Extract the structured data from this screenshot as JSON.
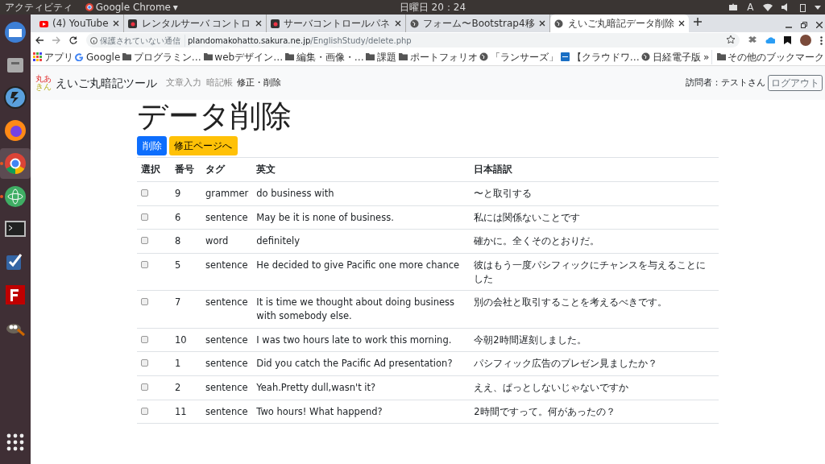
{
  "top_bar": {
    "activities": "アクティビティ",
    "app_menu": "Google Chrome",
    "app_caret": "▾",
    "clock": "日曜日 20：24",
    "input_method": "A"
  },
  "dock": [
    {
      "kind": "mail",
      "running": false,
      "selected": false
    },
    {
      "kind": "drawer",
      "running": false,
      "selected": false
    },
    {
      "kind": "bolt",
      "running": false,
      "selected": false
    },
    {
      "kind": "firefox",
      "running": false,
      "selected": false
    },
    {
      "kind": "chrome",
      "running": true,
      "selected": true
    },
    {
      "kind": "atom",
      "running": true,
      "selected": false
    },
    {
      "kind": "terminal",
      "running": false,
      "selected": false
    },
    {
      "kind": "tasks",
      "running": false,
      "selected": false
    },
    {
      "kind": "filezilla",
      "running": false,
      "selected": false
    },
    {
      "kind": "gimp",
      "running": false,
      "selected": false
    }
  ],
  "tabs": [
    {
      "kind": "youtube",
      "title": "(4) YouTube",
      "selected": false
    },
    {
      "kind": "server",
      "title": "レンタルサーバ コントロ",
      "selected": false
    },
    {
      "kind": "server",
      "title": "サーバコントロールパネ",
      "selected": false
    },
    {
      "kind": "globe",
      "title": "フォーム〜Bootstrap4移",
      "selected": false
    },
    {
      "kind": "globe",
      "title": "えいご丸暗記データ削除",
      "selected": true
    }
  ],
  "address_bar": {
    "security": "保護されていない通信",
    "url_host": "plandomakohatto.sakura.ne.jp",
    "url_path": "/EnglishStudy/delete.php"
  },
  "bookmarks": [
    {
      "kind": "apps",
      "label": "アプリ"
    },
    {
      "kind": "google",
      "label": "Google"
    },
    {
      "kind": "folder",
      "label": "プログラミン…"
    },
    {
      "kind": "folder",
      "label": "webデザイン…"
    },
    {
      "kind": "folder",
      "label": "編集・画像・…"
    },
    {
      "kind": "folder",
      "label": "課題"
    },
    {
      "kind": "folder",
      "label": "ポートフォリオ"
    },
    {
      "kind": "globe",
      "label": "「ランサーズ」"
    },
    {
      "kind": "cw",
      "label": "【クラウドワ…"
    },
    {
      "kind": "globe",
      "label": "日経電子版"
    }
  ],
  "bookmarks_more": "»",
  "other_bookmarks": "その他のブックマーク",
  "navbar": {
    "logo": [
      "丸あ",
      "きん"
    ],
    "brand": "えいご丸暗記ツール",
    "links": [
      {
        "label": "文章入力",
        "selected": false
      },
      {
        "label": "暗記帳",
        "selected": false
      },
      {
        "label": "修正・削除",
        "selected": true
      }
    ],
    "visitor": "訪問者：テストさん",
    "logout": "ログアウト"
  },
  "heading": "データ削除",
  "buttons": [
    {
      "kind": "primary",
      "label": "削除"
    },
    {
      "kind": "warning",
      "label": "修正ページへ"
    }
  ],
  "table": {
    "select_header": "選択",
    "columns": [
      "番号",
      "タグ",
      "英文",
      "日本語訳"
    ],
    "rows": [
      {
        "checked": false,
        "cells": [
          "9",
          "grammer",
          "do business with",
          "〜と取引する"
        ]
      },
      {
        "checked": false,
        "cells": [
          "6",
          "sentence",
          "May be it is none of business.",
          "私には関係ないことです"
        ]
      },
      {
        "checked": false,
        "cells": [
          "8",
          "word",
          "definitely",
          "確かに。全くそのとおりだ。"
        ]
      },
      {
        "checked": false,
        "cells": [
          "5",
          "sentence",
          "He decided to give Pacific one more chance",
          "彼はもう一度パシフィックにチャンスを与えることにした"
        ]
      },
      {
        "checked": false,
        "cells": [
          "7",
          "sentence",
          "It is time we thought about doing business with somebody else.",
          "別の会社と取引することを考えるべきです。"
        ]
      },
      {
        "checked": false,
        "cells": [
          "10",
          "sentence",
          "I was two hours late to work this morning.",
          "今朝2時間遅刻しました。"
        ]
      },
      {
        "checked": false,
        "cells": [
          "1",
          "sentence",
          "Did you catch the Pacific Ad presentation?",
          "パシフィック広告のプレゼン見ましたか？"
        ]
      },
      {
        "checked": false,
        "cells": [
          "2",
          "sentence",
          "Yeah.Pretty dull,wasn't it?",
          "ええ、ぱっとしないじゃないですか"
        ]
      },
      {
        "checked": false,
        "cells": [
          "11",
          "sentence",
          "Two hours! What happend?",
          "2時間ですって。何があったの？"
        ]
      }
    ]
  }
}
